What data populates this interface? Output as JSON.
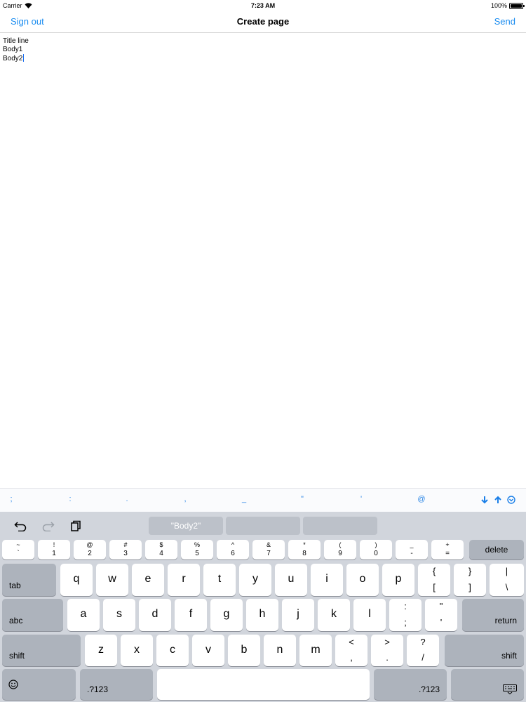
{
  "status_bar": {
    "carrier": "Carrier",
    "time": "7:23 AM",
    "battery": "100%"
  },
  "nav_bar": {
    "left_button": "Sign out",
    "title": "Create page",
    "right_button": "Send"
  },
  "editor": {
    "lines": [
      "Title line",
      "Body1",
      "Body2"
    ]
  },
  "punctuation_bar": {
    "keys": [
      ";",
      ":",
      ".",
      ",",
      "_",
      "\"",
      "'",
      "@"
    ]
  },
  "keyboard": {
    "suggestions": [
      "\"Body2\"",
      "",
      ""
    ],
    "number_row": [
      {
        "top": "~",
        "bot": "`"
      },
      {
        "top": "!",
        "bot": "1"
      },
      {
        "top": "@",
        "bot": "2"
      },
      {
        "top": "#",
        "bot": "3"
      },
      {
        "top": "$",
        "bot": "4"
      },
      {
        "top": "%",
        "bot": "5"
      },
      {
        "top": "^",
        "bot": "6"
      },
      {
        "top": "&",
        "bot": "7"
      },
      {
        "top": "*",
        "bot": "8"
      },
      {
        "top": "(",
        "bot": "9"
      },
      {
        "top": ")",
        "bot": "0"
      },
      {
        "top": "_",
        "bot": "-"
      },
      {
        "top": "+",
        "bot": "="
      }
    ],
    "delete_label": "delete",
    "tab_label": "tab",
    "row_q": [
      "q",
      "w",
      "e",
      "r",
      "t",
      "y",
      "u",
      "i",
      "o",
      "p"
    ],
    "row_q_dual": [
      {
        "top": "{",
        "bot": "["
      },
      {
        "top": "}",
        "bot": "]"
      },
      {
        "top": "|",
        "bot": "\\"
      }
    ],
    "abc_label": "abc",
    "row_a": [
      "a",
      "s",
      "d",
      "f",
      "g",
      "h",
      "j",
      "k",
      "l"
    ],
    "row_a_dual": [
      {
        "top": ":",
        "bot": ";"
      },
      {
        "top": "\"",
        "bot": "'"
      }
    ],
    "return_label": "return",
    "shift_label": "shift",
    "row_z": [
      "z",
      "x",
      "c",
      "v",
      "b",
      "n",
      "m"
    ],
    "row_z_dual": [
      {
        "top": "<",
        "bot": ","
      },
      {
        "top": ">",
        "bot": "."
      },
      {
        "top": "?",
        "bot": "/"
      }
    ],
    "mode_label": ".?123",
    "emoji_icon": "emoji-icon",
    "dismiss_icon": "keyboard-dismiss-icon"
  },
  "colors": {
    "accent": "#1a8cf0",
    "keyboard_bg": "#d1d5dc",
    "func_key": "#adb3bc"
  }
}
